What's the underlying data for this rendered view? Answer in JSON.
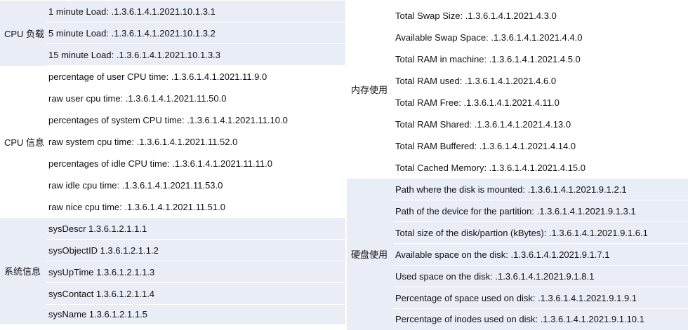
{
  "left": {
    "groups": [
      {
        "label": "CPU 负载",
        "items": [
          "1 minute Load: .1.3.6.1.4.1.2021.10.1.3.1",
          "5 minute Load: .1.3.6.1.4.1.2021.10.1.3.2",
          "15 minute Load: .1.3.6.1.4.1.2021.10.1.3.3"
        ]
      },
      {
        "label": "CPU 信息",
        "items": [
          "percentage of user CPU time: .1.3.6.1.4.1.2021.11.9.0",
          "raw user cpu time: .1.3.6.1.4.1.2021.11.50.0",
          "percentages of system CPU time: .1.3.6.1.4.1.2021.11.10.0",
          "raw system cpu time: .1.3.6.1.4.1.2021.11.52.0",
          "percentages of idle CPU time: .1.3.6.1.4.1.2021.11.11.0",
          "raw idle cpu time: .1.3.6.1.4.1.2021.11.53.0",
          "raw nice cpu time: .1.3.6.1.4.1.2021.11.51.0"
        ]
      },
      {
        "label": "系统信息",
        "items": [
          "sysDescr 1.3.6.1.2.1.1.1",
          "sysObjectID 1.3.6.1.2.1.1.2",
          "sysUpTime 1.3.6.1.2.1.1.3",
          "sysContact 1.3.6.1.2.1.1.4",
          "sysName 1.3.6.1.2.1.1.5"
        ]
      }
    ]
  },
  "right": {
    "groups": [
      {
        "label": "内存使用",
        "items": [
          "Total Swap Size: .1.3.6.1.4.1.2021.4.3.0",
          "Available Swap Space: .1.3.6.1.4.1.2021.4.4.0",
          "Total RAM in machine: .1.3.6.1.4.1.2021.4.5.0",
          "Total RAM used: .1.3.6.1.4.1.2021.4.6.0",
          "Total RAM Free: .1.3.6.1.4.1.2021.4.11.0",
          "Total RAM Shared: .1.3.6.1.4.1.2021.4.13.0",
          "Total RAM Buffered: .1.3.6.1.4.1.2021.4.14.0",
          "Total Cached Memory: .1.3.6.1.4.1.2021.4.15.0"
        ]
      },
      {
        "label": "硬盘使用",
        "items": [
          "Path where the disk is mounted: .1.3.6.1.4.1.2021.9.1.2.1",
          "Path of the device for the partition: .1.3.6.1.4.1.2021.9.1.3.1",
          "Total size of the disk/partion (kBytes): .1.3.6.1.4.1.2021.9.1.6.1",
          "Available space on the disk: .1.3.6.1.4.1.2021.9.1.7.1",
          "Used space on the disk: .1.3.6.1.4.1.2021.9.1.8.1",
          "Percentage of space used on disk: .1.3.6.1.4.1.2021.9.1.9.1",
          "Percentage of inodes used on disk: .1.3.6.1.4.1.2021.9.1.10.1"
        ]
      }
    ]
  }
}
